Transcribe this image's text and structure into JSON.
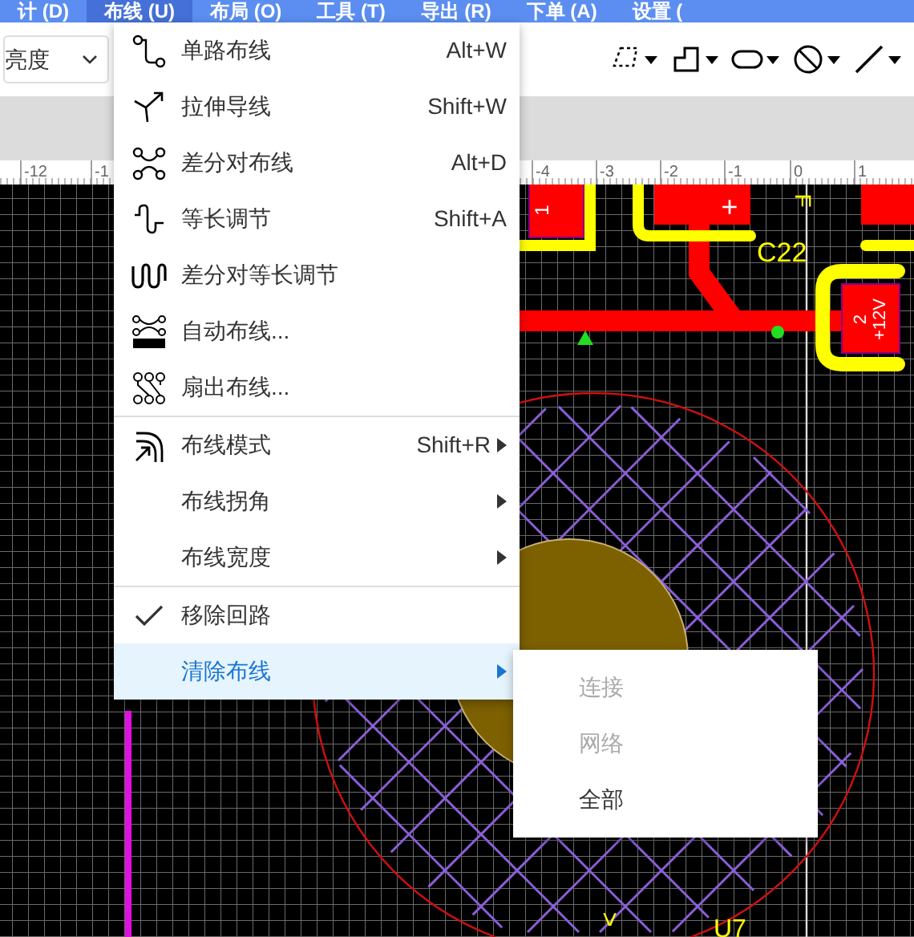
{
  "menubar": [
    {
      "label": "计 (D)",
      "selected": false
    },
    {
      "label": "布线 (U)",
      "selected": true
    },
    {
      "label": "布局 (O)",
      "selected": false
    },
    {
      "label": "工具 (T)",
      "selected": false
    },
    {
      "label": "导出 (R)",
      "selected": false
    },
    {
      "label": "下单 (A)",
      "selected": false
    },
    {
      "label": "设置 (",
      "selected": false
    }
  ],
  "toolbar": {
    "layer_select": {
      "value": "亮度"
    }
  },
  "ruler": {
    "labels": [
      "-12",
      "-1",
      "-4",
      "-3",
      "-2",
      "-1",
      "0",
      "1"
    ]
  },
  "canvas": {
    "labels": [
      "1",
      "+",
      "F",
      "C22",
      "2",
      "+12V",
      ">",
      "U7"
    ]
  },
  "menu": {
    "groups": [
      [
        {
          "label": "单路布线",
          "shortcut": "Alt+W",
          "checked": false,
          "submenu": false,
          "selected": false
        },
        {
          "label": "拉伸导线",
          "shortcut": "Shift+W",
          "checked": false,
          "submenu": false,
          "selected": false
        },
        {
          "label": "差分对布线",
          "shortcut": "Alt+D",
          "checked": false,
          "submenu": false,
          "selected": false
        },
        {
          "label": "等长调节",
          "shortcut": "Shift+A",
          "checked": false,
          "submenu": false,
          "selected": false
        },
        {
          "label": "差分对等长调节",
          "checked": false,
          "submenu": false,
          "selected": false
        },
        {
          "label": "自动布线...",
          "checked": false,
          "submenu": false,
          "selected": false
        },
        {
          "label": "扇出布线...",
          "checked": false,
          "submenu": false,
          "selected": false
        }
      ],
      [
        {
          "label": "布线模式",
          "shortcut": "Shift+R",
          "checked": false,
          "submenu": true,
          "selected": false
        },
        {
          "label": "布线拐角",
          "checked": false,
          "submenu": true,
          "selected": false
        },
        {
          "label": "布线宽度",
          "checked": false,
          "submenu": true,
          "selected": false
        }
      ],
      [
        {
          "label": "移除回路",
          "checked": true,
          "submenu": false,
          "selected": false
        },
        {
          "label": "清除布线",
          "checked": false,
          "submenu": true,
          "selected": true
        }
      ]
    ]
  },
  "submenu": [
    {
      "label": "连接",
      "disabled": true
    },
    {
      "label": "网络",
      "disabled": true
    },
    {
      "label": "全部",
      "disabled": false
    }
  ]
}
